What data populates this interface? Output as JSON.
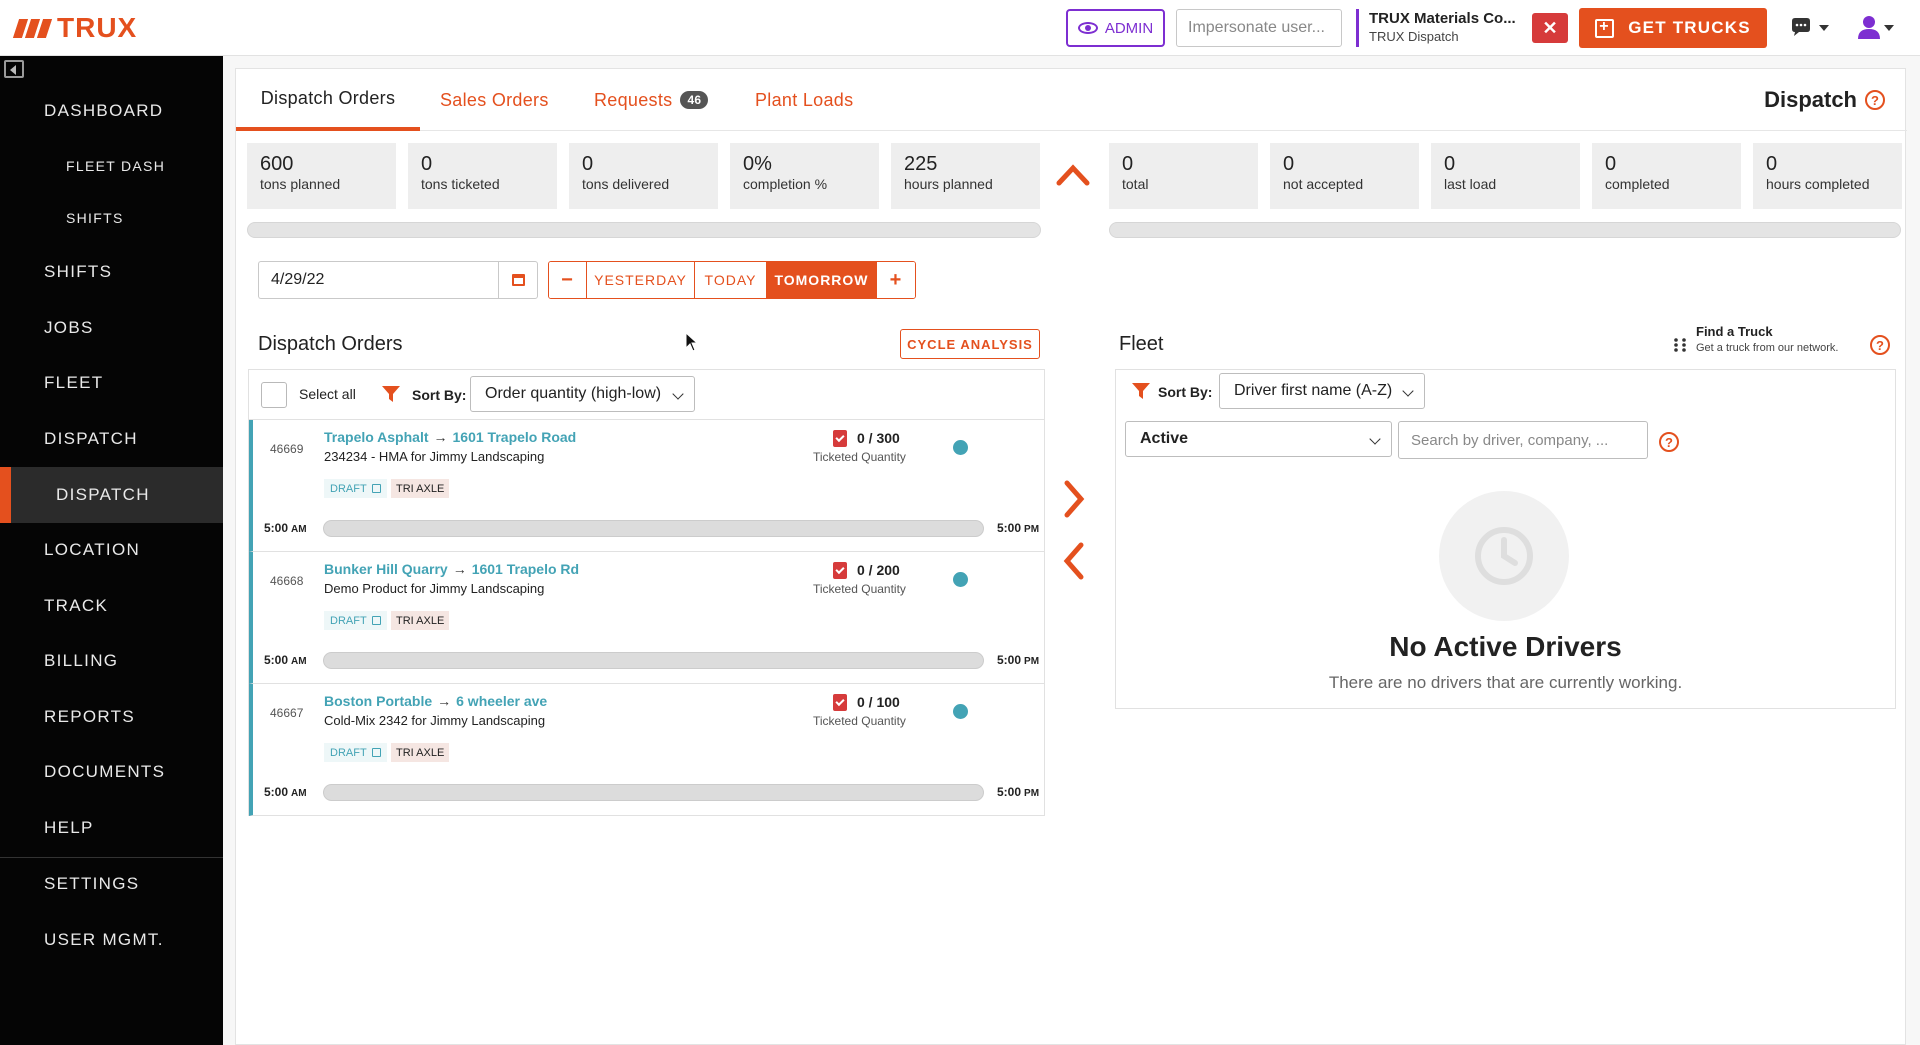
{
  "brand": {
    "logo_text": "TRUX",
    "accent_color": "#e4501e",
    "admin_color": "#7d2ed1"
  },
  "topbar": {
    "admin_label": "ADMIN",
    "impersonate_placeholder": "Impersonate user...",
    "company_name": "TRUX Materials Co...",
    "company_sub": "TRUX Dispatch",
    "close_symbol": "✕",
    "get_trucks_label": "GET TRUCKS"
  },
  "sidebar": {
    "items": [
      {
        "label": "DASHBOARD",
        "kind": "main"
      },
      {
        "label": "FLEET DASH",
        "kind": "sub"
      },
      {
        "label": "SHIFTS",
        "kind": "sub"
      },
      {
        "label": "SHIFTS",
        "kind": "main"
      },
      {
        "label": "JOBS",
        "kind": "main"
      },
      {
        "label": "FLEET",
        "kind": "main"
      },
      {
        "label": "DISPATCH",
        "kind": "main"
      },
      {
        "label": "DISPATCH",
        "kind": "active"
      },
      {
        "label": "LOCATION",
        "kind": "main"
      },
      {
        "label": "TRACK",
        "kind": "main"
      },
      {
        "label": "BILLING",
        "kind": "main"
      },
      {
        "label": "REPORTS",
        "kind": "main"
      },
      {
        "label": "DOCUMENTS",
        "kind": "main"
      },
      {
        "label": "HELP",
        "kind": "main"
      },
      {
        "label": "SETTINGS",
        "kind": "main"
      },
      {
        "label": "USER MGMT.",
        "kind": "main"
      }
    ]
  },
  "tabs": [
    {
      "label": "Dispatch Orders",
      "active": true
    },
    {
      "label": "Sales Orders"
    },
    {
      "label": "Requests",
      "badge": "46"
    },
    {
      "label": "Plant Loads"
    }
  ],
  "page_title": "Dispatch",
  "help_symbol": "?",
  "stats_left": [
    {
      "value": "600",
      "label": "tons planned"
    },
    {
      "value": "0",
      "label": "tons ticketed"
    },
    {
      "value": "0",
      "label": "tons delivered"
    },
    {
      "value": "0%",
      "label": "completion %"
    },
    {
      "value": "225",
      "label": "hours planned"
    }
  ],
  "stats_right": [
    {
      "value": "0",
      "label": "total"
    },
    {
      "value": "0",
      "label": "not accepted"
    },
    {
      "value": "0",
      "label": "last load"
    },
    {
      "value": "0",
      "label": "completed"
    },
    {
      "value": "0",
      "label": "hours completed"
    }
  ],
  "date_controls": {
    "date_value": "4/29/22",
    "minus": "−",
    "yesterday": "YESTERDAY",
    "today": "TODAY",
    "tomorrow": "TOMORROW",
    "plus": "+",
    "selected": "TOMORROW"
  },
  "dispatch_orders": {
    "title": "Dispatch Orders",
    "cycle_analysis": "CYCLE ANALYSIS",
    "select_all": "Select all",
    "sort_label": "Sort By:",
    "sort_value": "Order quantity (high-low)",
    "orders": [
      {
        "id": "46669",
        "from": "Trapelo Asphalt",
        "to": "1601 Trapelo Road",
        "desc": "234234 - HMA for Jimmy Landscaping",
        "status": "DRAFT",
        "truck": "TRI AXLE",
        "ticketed": "0 / 300",
        "ticketed_label": "Ticketed Quantity",
        "start": "5:00",
        "start_ampm": "AM",
        "end": "5:00",
        "end_ampm": "PM"
      },
      {
        "id": "46668",
        "from": "Bunker Hill Quarry",
        "to": "1601 Trapelo Rd",
        "desc": "Demo Product for Jimmy Landscaping",
        "status": "DRAFT",
        "truck": "TRI AXLE",
        "ticketed": "0 / 200",
        "ticketed_label": "Ticketed Quantity",
        "start": "5:00",
        "start_ampm": "AM",
        "end": "5:00",
        "end_ampm": "PM"
      },
      {
        "id": "46667",
        "from": "Boston Portable",
        "to": "6 wheeler ave",
        "desc": "Cold-Mix 2342 for Jimmy Landscaping",
        "status": "DRAFT",
        "truck": "TRI AXLE",
        "ticketed": "0 / 100",
        "ticketed_label": "Ticketed Quantity",
        "start": "5:00",
        "start_ampm": "AM",
        "end": "5:00",
        "end_ampm": "PM"
      }
    ]
  },
  "fleet": {
    "title": "Fleet",
    "find_truck_title": "Find a Truck",
    "find_truck_sub": "Get a truck from our network.",
    "sort_label": "Sort By:",
    "sort_value": "Driver first name (A-Z)",
    "status_value": "Active",
    "search_placeholder": "Search by driver, company, ...",
    "empty_title": "No Active Drivers",
    "empty_sub": "There are no drivers that are currently working."
  }
}
